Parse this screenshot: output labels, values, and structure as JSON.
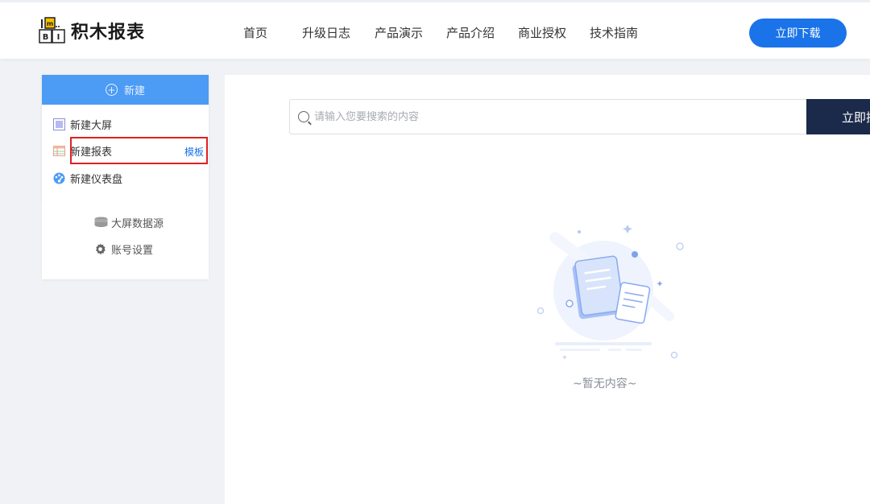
{
  "header": {
    "logo_text": "积木报表",
    "nav": [
      {
        "label": "首页"
      },
      {
        "label": "升级日志"
      },
      {
        "label": "产品演示"
      },
      {
        "label": "产品介绍"
      },
      {
        "label": "商业授权"
      },
      {
        "label": "技术指南"
      }
    ],
    "download_label": "立即下载"
  },
  "sidebar": {
    "new_label": "新建",
    "new_items": [
      {
        "label": "新建大屏",
        "icon": "screen-icon"
      },
      {
        "label": "新建报表",
        "icon": "table-icon",
        "extra": "模板"
      },
      {
        "label": "新建仪表盘",
        "icon": "dashboard-icon"
      }
    ],
    "other_items": [
      {
        "label": "大屏数据源",
        "icon": "database-icon"
      },
      {
        "label": "账号设置",
        "icon": "gear-icon"
      }
    ]
  },
  "main": {
    "search_placeholder": "请输入您要搜索的内容",
    "search_button": "立即搜",
    "empty_text": "~暂无内容~"
  },
  "colors": {
    "primary": "#1a73e8",
    "new_button": "#4c9bf5",
    "search_button": "#1b2a4a",
    "highlight_border": "#e02020"
  }
}
